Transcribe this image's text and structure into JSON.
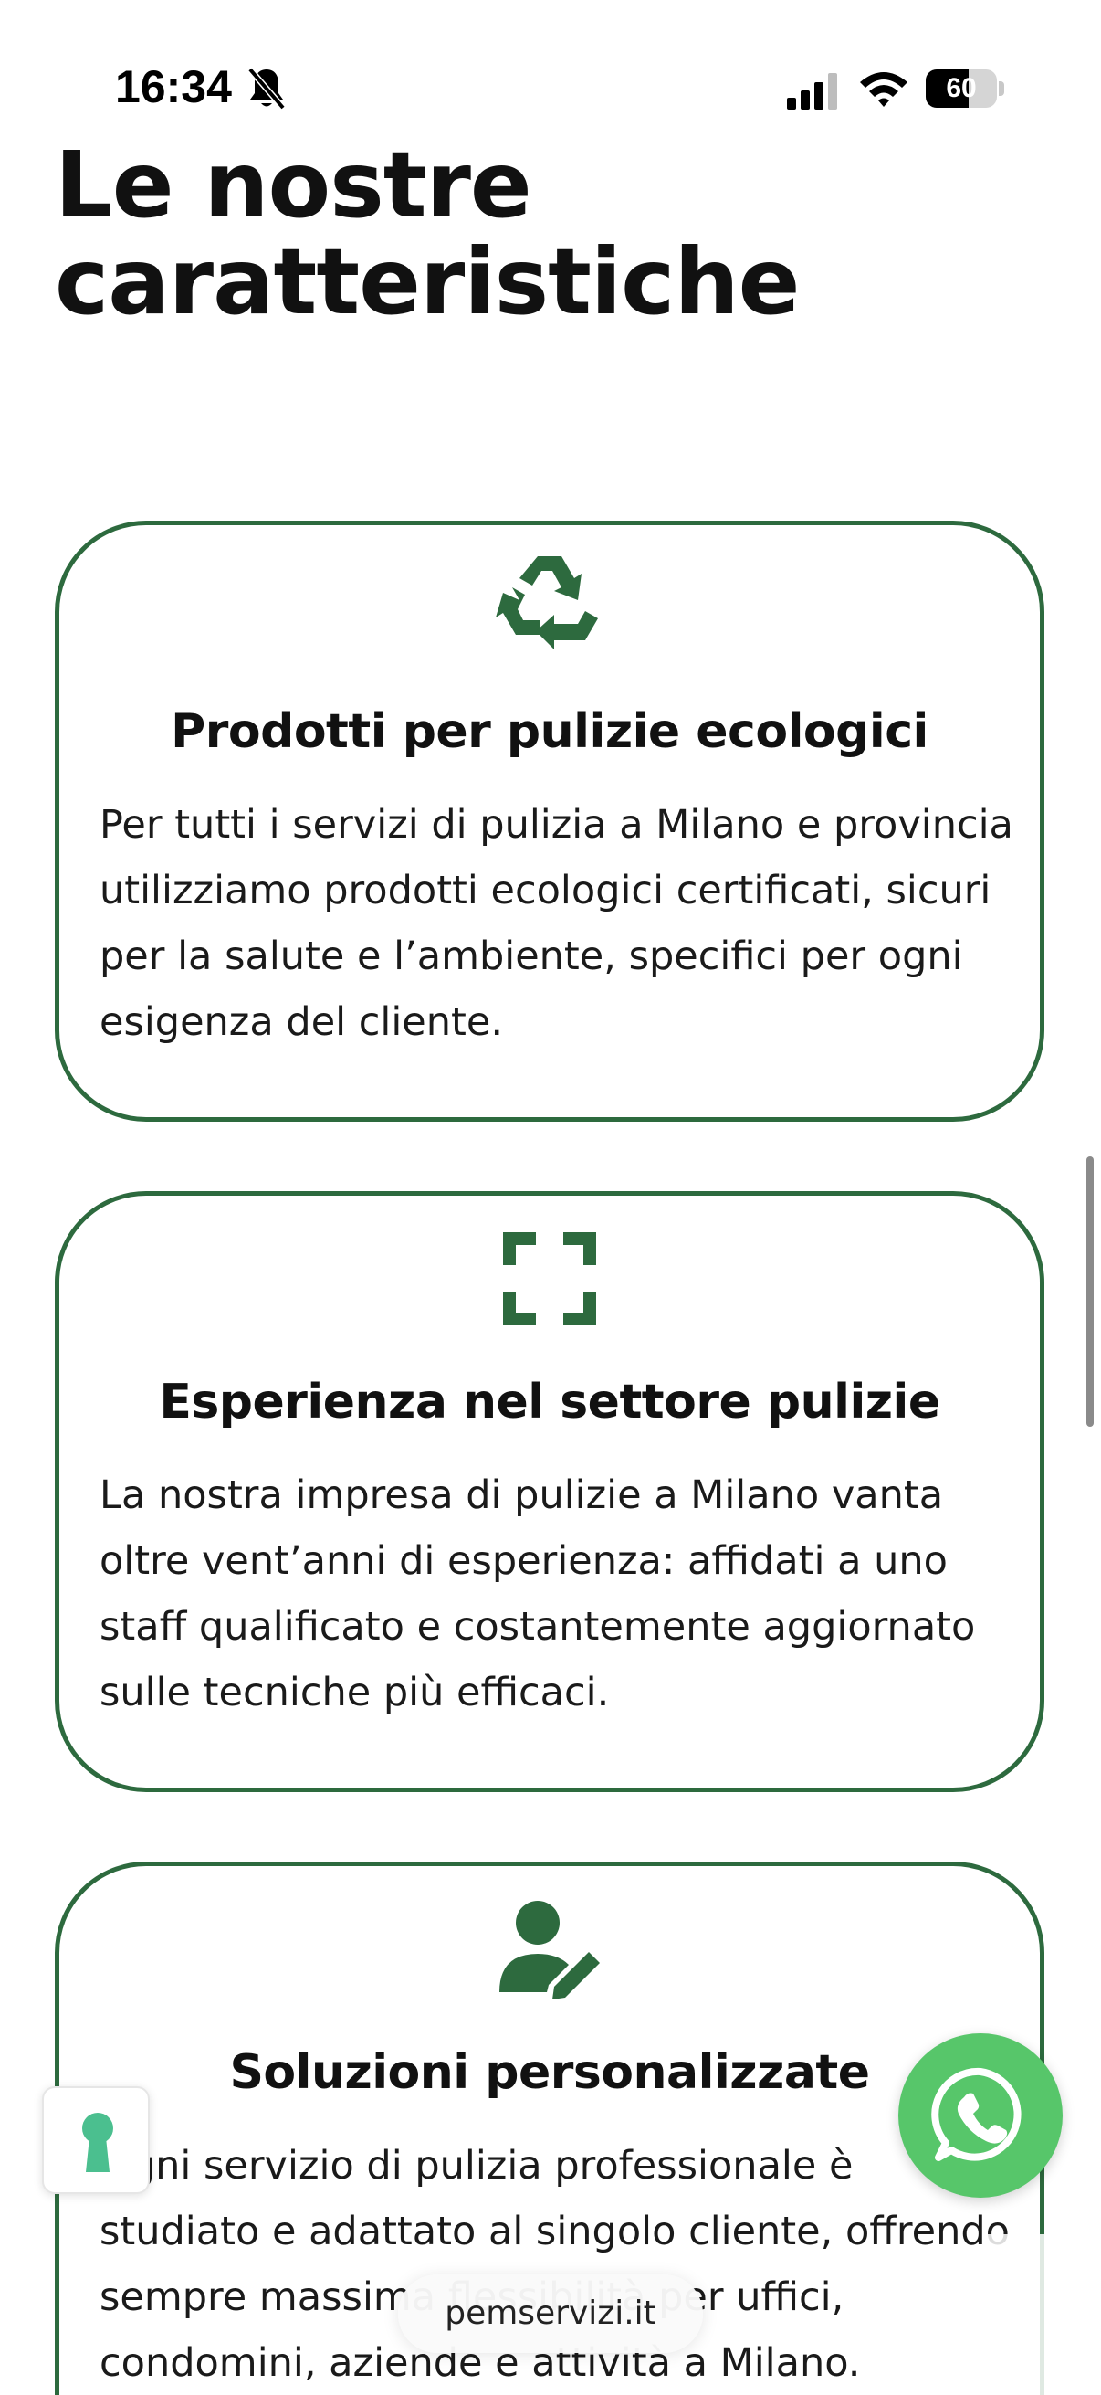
{
  "status_bar": {
    "time": "16:34",
    "battery": "60",
    "battery_level": 0.6,
    "icons": [
      "bell-slash-icon",
      "cellular-signal-icon",
      "wifi-icon",
      "battery-icon"
    ]
  },
  "section": {
    "title": "Le nostre caratteristiche"
  },
  "cards": [
    {
      "icon": "recycle-icon",
      "title": "Prodotti per pulizie ecologici",
      "text": "Per tutti i servizi di pulizia a Milano e provincia utilizziamo prodotti ecologici certificati, sicuri per la salute e l’ambiente, specifici per ogni esigenza del cliente."
    },
    {
      "icon": "expand-icon",
      "title": "Esperienza nel settore pulizie",
      "text": "La nostra impresa di pulizie a Milano vanta oltre vent’anni di esperienza: affidati a uno staff qualificato e costantemente aggiornato sulle tecniche più efficaci."
    },
    {
      "icon": "user-edit-icon",
      "title": "Soluzioni personalizzate",
      "text": "Ogni servizio di pulizia professionale è studiato e adattato al singolo cliente, offrendo sempre massima flessibilità per uffici, condomini, aziende e attività a Milano."
    }
  ],
  "floating": {
    "whatsapp_icon": "whatsapp-icon",
    "lock_icon": "keyhole-icon"
  },
  "browser": {
    "url": "pemservizi.it"
  },
  "colors": {
    "accent": "#2d6a3e",
    "whatsapp": "#57c66a",
    "text": "#111111"
  }
}
